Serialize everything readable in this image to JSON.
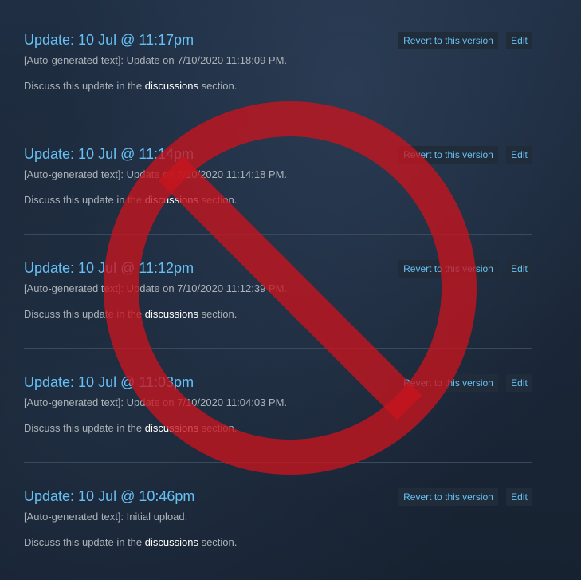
{
  "page": {
    "background": "#1b2838",
    "accent": "#66c0f4",
    "overlay_color": "#c8141e"
  },
  "changelog": {
    "entries": [
      {
        "title": "Update: 10 Jul @ 11:17pm",
        "description": "[Auto-generated text]: Update on 7/10/2020 11:18:09 PM.",
        "discuss_prefix": "Discuss this update in the ",
        "discuss_link": "discussions",
        "discuss_suffix": " section.",
        "revert_label": "Revert to this version",
        "edit_label": "Edit"
      },
      {
        "title": "Update: 10 Jul @ 11:14pm",
        "description": "[Auto-generated text]: Update on 7/10/2020 11:14:18 PM.",
        "discuss_prefix": "Discuss this update in the ",
        "discuss_link": "discussions",
        "discuss_suffix": " section.",
        "revert_label": "Revert to this version",
        "edit_label": "Edit"
      },
      {
        "title": "Update: 10 Jul @ 11:12pm",
        "description": "[Auto-generated text]: Update on 7/10/2020 11:12:39 PM.",
        "discuss_prefix": "Discuss this update in the ",
        "discuss_link": "discussions",
        "discuss_suffix": " section.",
        "revert_label": "Revert to this version",
        "edit_label": "Edit"
      },
      {
        "title": "Update: 10 Jul @ 11:03pm",
        "description": "[Auto-generated text]: Update on 7/10/2020 11:04:03 PM.",
        "discuss_prefix": "Discuss this update in the ",
        "discuss_link": "discussions",
        "discuss_suffix": " section.",
        "revert_label": "Revert to this version",
        "edit_label": "Edit"
      },
      {
        "title": "Update: 10 Jul @ 10:46pm",
        "description": "[Auto-generated text]: Initial upload.",
        "discuss_prefix": "Discuss this update in the ",
        "discuss_link": "discussions",
        "discuss_suffix": " section.",
        "revert_label": "Revert to this version",
        "edit_label": "Edit"
      }
    ]
  }
}
